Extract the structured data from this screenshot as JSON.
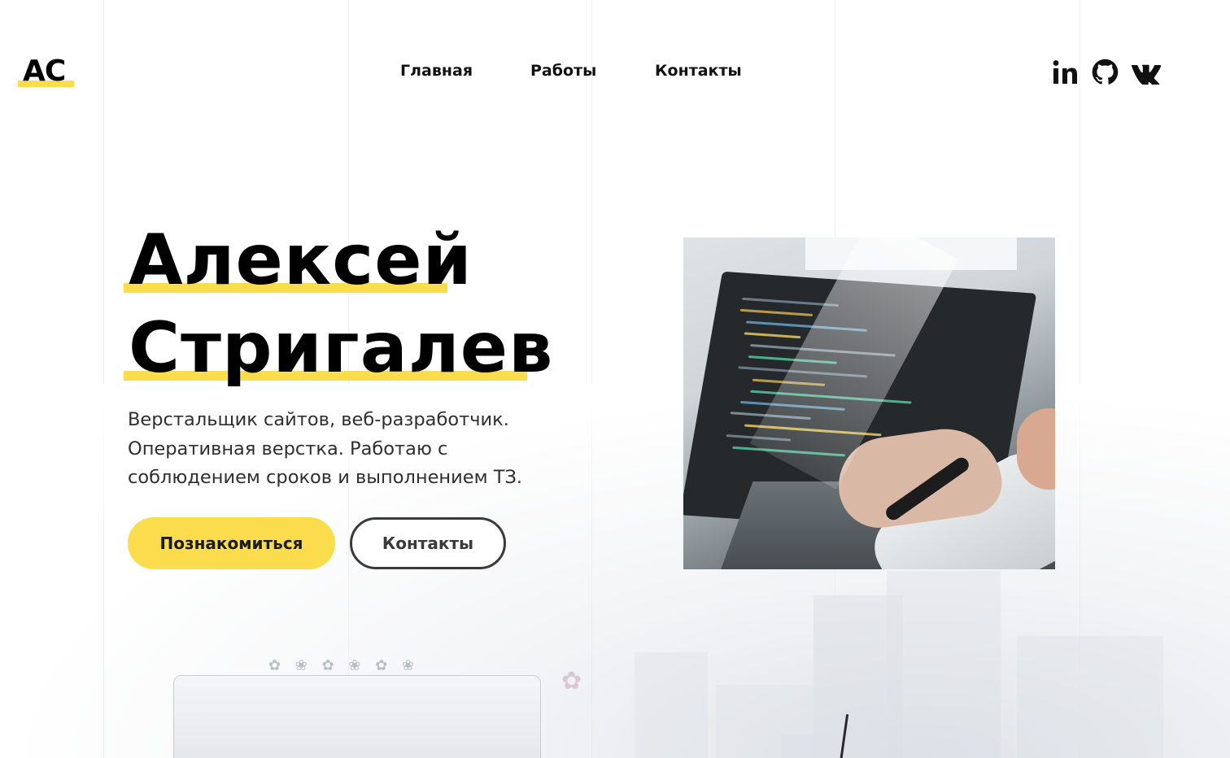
{
  "header": {
    "logo": "AC",
    "nav": [
      {
        "label": "Главная"
      },
      {
        "label": "Работы"
      },
      {
        "label": "Контакты"
      }
    ],
    "social": [
      {
        "name": "linkedin-icon"
      },
      {
        "name": "github-icon"
      },
      {
        "name": "vk-icon"
      }
    ]
  },
  "hero": {
    "name_line1": "Алексей",
    "name_line2": "Стригалев",
    "subtitle_lines": [
      "Верстальщик сайтов, веб-разработчик.",
      "Оперативная верстка. Работаю с",
      "соблюдением сроков и выполнением ТЗ."
    ],
    "primary_button": "Познакомиться",
    "secondary_button": "Контакты",
    "photo_alt": "laptop-with-code-photo"
  },
  "colors": {
    "accent": "#fbdc4d",
    "text": "#000000",
    "subtitle": "#2f2f2f",
    "outline_button": "#3a3a3a"
  }
}
